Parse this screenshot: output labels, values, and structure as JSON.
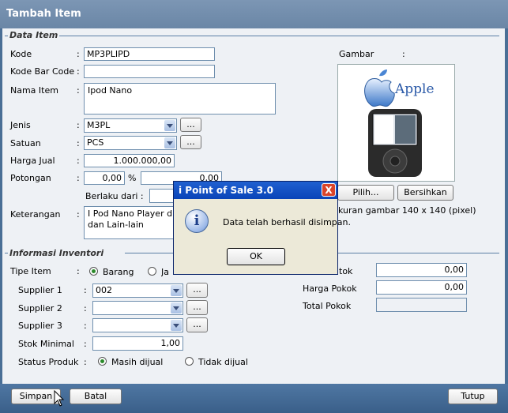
{
  "window": {
    "title": "Tambah Item"
  },
  "data_item": {
    "section_title": "Data Item",
    "kode": {
      "label": "Kode",
      "value": "MP3PLIPD"
    },
    "kode_bar_code": {
      "label": "Kode Bar Code",
      "value": ""
    },
    "nama_item": {
      "label": "Nama Item",
      "value": "Ipod Nano"
    },
    "jenis": {
      "label": "Jenis",
      "value": "M3PL"
    },
    "satuan": {
      "label": "Satuan",
      "value": "PCS"
    },
    "harga_jual": {
      "label": "Harga Jual",
      "value": "1.000.000,00"
    },
    "potongan": {
      "label": "Potongan",
      "value": "0,00",
      "percent": "%",
      "amount": "0,00"
    },
    "berlaku_dari": {
      "label": "Berlaku dari :"
    },
    "keterangan": {
      "label": "Keterangan",
      "value": "I Pod Nano Player d\ndan Lain-lain"
    },
    "colon": ":",
    "browse": "...",
    "gambar": {
      "label": "Gambar",
      "colon": ":",
      "logo_text": "Apple",
      "pilih": "Pilih...",
      "bersihkan": "Bersihkan",
      "size_note": "kuran gambar 140 x 140 (pixel)"
    }
  },
  "inventori": {
    "section_title": "Informasi Inventori",
    "tipe_item": {
      "label": "Tipe Item",
      "options": [
        "Barang",
        "Ja"
      ],
      "selected": "Barang"
    },
    "supplier1": {
      "label": "Supplier 1",
      "value": "002"
    },
    "supplier2": {
      "label": "Supplier 2",
      "value": ""
    },
    "supplier3": {
      "label": "Supplier 3",
      "value": ""
    },
    "stok_minimal": {
      "label": "Stok Minimal",
      "value": "1,00"
    },
    "status_produk": {
      "label": "Status Produk",
      "options": [
        "Masih dijual",
        "Tidak dijual"
      ],
      "selected": "Masih dijual"
    },
    "stok": {
      "label": "tok",
      "value": "0,00"
    },
    "harga_pokok": {
      "label": "Harga Pokok",
      "value": "0,00"
    },
    "total_pokok": {
      "label": "Total Pokok",
      "value": ""
    }
  },
  "footer": {
    "simpan": "Simpan",
    "batal": "Batal",
    "tutup": "Tutup"
  },
  "dialog": {
    "title": "i Point of Sale 3.0",
    "message": "Data telah berhasil disimpan.",
    "ok": "OK",
    "close": "X",
    "icon": "i"
  }
}
